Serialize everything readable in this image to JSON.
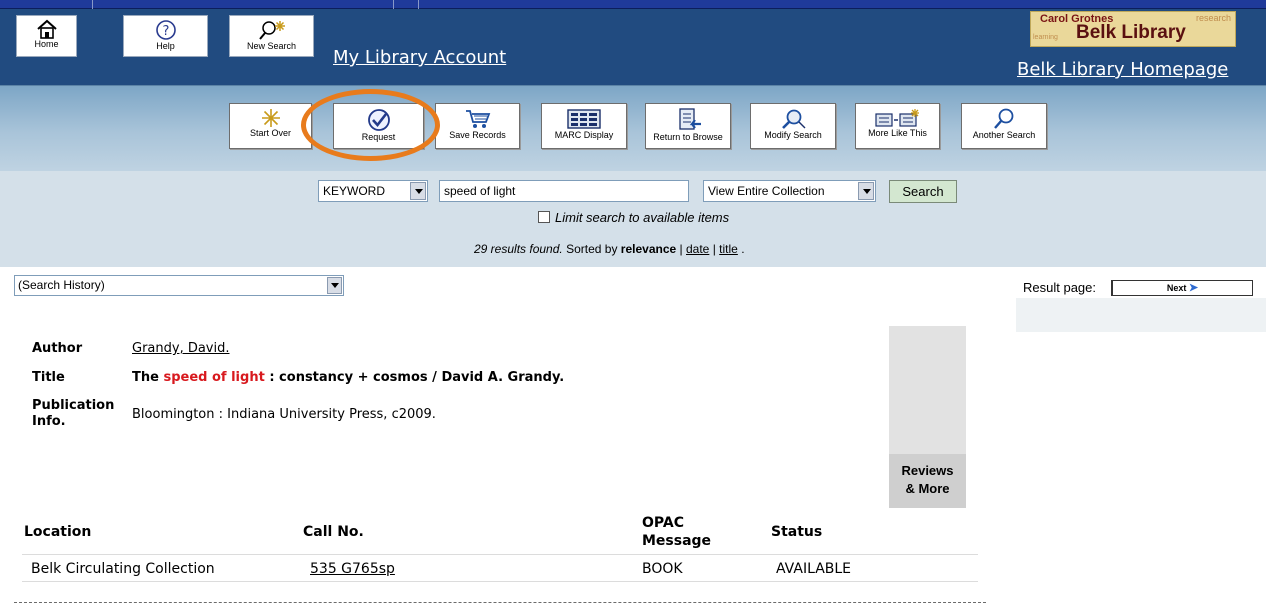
{
  "header": {
    "nav_buttons": [
      {
        "label": "Home",
        "icon": "home-icon"
      },
      {
        "label": "Help",
        "icon": "help-icon"
      },
      {
        "label": "New Search",
        "icon": "new-search-icon"
      }
    ],
    "account_link": "My Library Account",
    "logo": {
      "line1": "Carol Grotnes",
      "line2": "Belk Library",
      "tag_right": "research",
      "tag_left": "learning"
    },
    "homepage_link": "Belk Library Homepage",
    "colors": {
      "banner": "#214b80",
      "top_strip": "#1f3a9a"
    }
  },
  "toolbar": {
    "buttons": [
      {
        "label": "Start Over",
        "icon": "start-over-icon"
      },
      {
        "label": "Request",
        "icon": "checkmark-icon"
      },
      {
        "label": "Save Records",
        "icon": "cart-icon"
      },
      {
        "label": "MARC Display",
        "icon": "marc-display-icon"
      },
      {
        "label": "Return to Browse",
        "icon": "return-browse-icon"
      },
      {
        "label": "Modify Search",
        "icon": "modify-search-icon"
      },
      {
        "label": "More Like This",
        "icon": "more-like-this-icon"
      },
      {
        "label": "Another Search",
        "icon": "magnifier-icon"
      }
    ],
    "highlight_color": "#e87b1c"
  },
  "search": {
    "type_select": "KEYWORD",
    "query": "speed of light",
    "scope_select": "View Entire Collection",
    "submit_label": "Search",
    "limit_label": "Limit search to available items",
    "limit_checked": false,
    "results": {
      "count_text": "29 results found.",
      "sorted_by_text": "Sorted by",
      "sort_current": "relevance",
      "sort_date": "date",
      "sort_title": "title",
      "separator": "|",
      "end_punct": "."
    }
  },
  "history": {
    "select_value": "(Search History)"
  },
  "paging": {
    "label": "Result page:",
    "next_label": "Next"
  },
  "record": {
    "author_label": "Author",
    "author_value": "Grandy, David.",
    "title_label": "Title",
    "title_prefix": "The",
    "title_highlight": "speed of light",
    "title_suffix": ": constancy + cosmos / David A. Grandy.",
    "pubinfo_label_1": "Publication",
    "pubinfo_label_2": "Info.",
    "pubinfo_value": "Bloomington : Indiana University Press, c2009.",
    "reviews_line1": "Reviews",
    "reviews_line2": "& More"
  },
  "holdings": {
    "headers": {
      "location": "Location",
      "call_no": "Call No.",
      "opac_1": "OPAC",
      "opac_2": "Message",
      "status": "Status"
    },
    "rows": [
      {
        "location": "Belk Circulating Collection",
        "call_no": "535 G765sp",
        "opac": "BOOK",
        "status": "AVAILABLE"
      }
    ]
  }
}
